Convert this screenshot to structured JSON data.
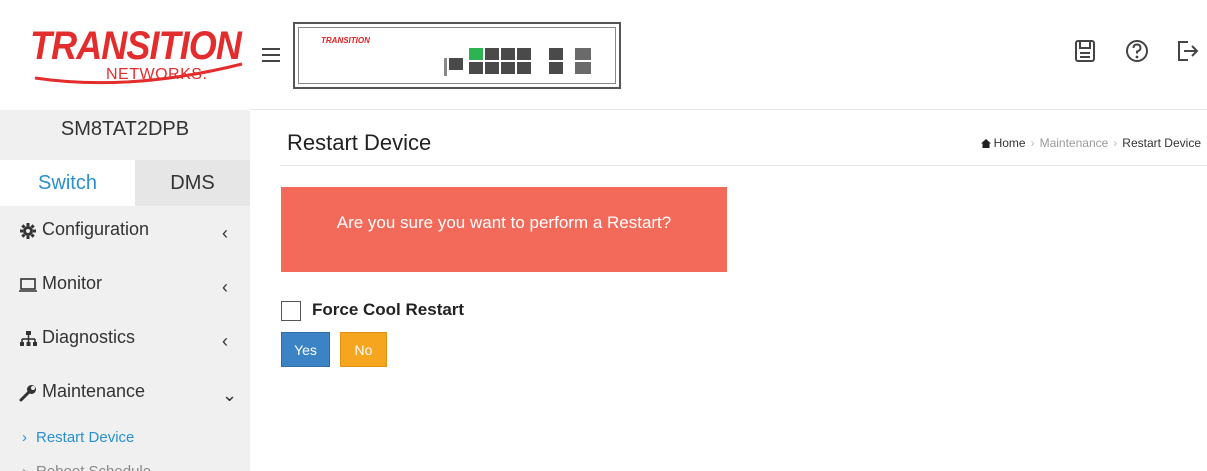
{
  "header": {
    "logo_main": "TRANSITION",
    "logo_sub": "NETWORKS.",
    "device_brand": "TRANSITION",
    "icons": [
      "save-icon",
      "help-icon",
      "logout-icon"
    ]
  },
  "sidebar": {
    "device_name": "SM8TAT2DPB",
    "tabs": [
      {
        "label": "Switch",
        "active": true
      },
      {
        "label": "DMS",
        "active": false
      }
    ],
    "items": [
      {
        "label": "Configuration",
        "icon": "gear-icon",
        "caret": "‹"
      },
      {
        "label": "Monitor",
        "icon": "laptop-icon",
        "caret": "‹"
      },
      {
        "label": "Diagnostics",
        "icon": "sitemap-icon",
        "caret": "‹"
      },
      {
        "label": "Maintenance",
        "icon": "wrench-icon",
        "caret": "⌄"
      }
    ],
    "sub_items": [
      {
        "label": "Restart Device",
        "arrow": "›"
      },
      {
        "label": "Reboot Schedule",
        "arrow": "›"
      }
    ]
  },
  "main": {
    "title": "Restart Device",
    "breadcrumb": {
      "home": "Home",
      "section": "Maintenance",
      "current": "Restart Device"
    },
    "alert_text": "Are you sure you want to perform a Restart?",
    "checkbox_label": "Force Cool Restart",
    "yes_label": "Yes",
    "no_label": "No"
  },
  "colors": {
    "accent": "#2a8fcf",
    "alert": "#f36a5a",
    "yes": "#3b83c4",
    "no": "#f5a51e",
    "logo": "#e32d2d"
  }
}
